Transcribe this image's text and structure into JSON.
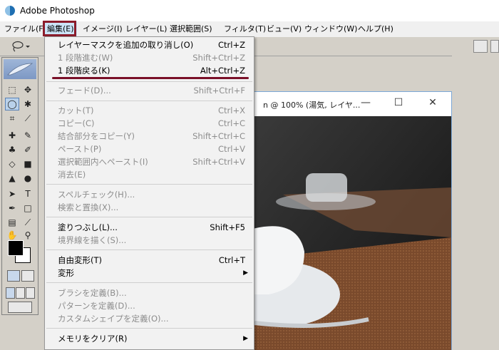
{
  "app": {
    "title": "Adobe Photoshop"
  },
  "menubar": {
    "items": [
      "ファイル(F)",
      "編集(E)",
      "イメージ(I)",
      "レイヤー(L)",
      "選択範囲(S)",
      "フィルタ(T)",
      "ビュー(V)",
      "ウィンドウ(W)",
      "ヘルプ(H)"
    ]
  },
  "document": {
    "title": "n @ 100% (湯気, レイヤ...",
    "minimize": "—",
    "maximize": "☐",
    "close": "✕"
  },
  "edit_menu": {
    "items": [
      {
        "label": "レイヤーマスクを追加の取り消し(O)",
        "shortcut": "Ctrl+Z",
        "enabled": true
      },
      {
        "label": "1 段階進む(W)",
        "shortcut": "Shift+Ctrl+Z",
        "enabled": false
      },
      {
        "label": "1 段階戻る(K)",
        "shortcut": "Alt+Ctrl+Z",
        "enabled": true
      },
      {
        "label": "フェード(D)...",
        "shortcut": "Shift+Ctrl+F",
        "enabled": false
      },
      {
        "label": "カット(T)",
        "shortcut": "Ctrl+X",
        "enabled": false
      },
      {
        "label": "コピー(C)",
        "shortcut": "Ctrl+C",
        "enabled": false
      },
      {
        "label": "結合部分をコピー(Y)",
        "shortcut": "Shift+Ctrl+C",
        "enabled": false
      },
      {
        "label": "ペースト(P)",
        "shortcut": "Ctrl+V",
        "enabled": false
      },
      {
        "label": "選択範囲内へペースト(I)",
        "shortcut": "Shift+Ctrl+V",
        "enabled": false
      },
      {
        "label": "消去(E)",
        "shortcut": "",
        "enabled": false
      },
      {
        "label": "スペルチェック(H)...",
        "shortcut": "",
        "enabled": false
      },
      {
        "label": "検索と置換(X)...",
        "shortcut": "",
        "enabled": false
      },
      {
        "label": "塗りつぶし(L)...",
        "shortcut": "Shift+F5",
        "enabled": true
      },
      {
        "label": "境界線を描く(S)...",
        "shortcut": "",
        "enabled": false
      },
      {
        "label": "自由変形(T)",
        "shortcut": "Ctrl+T",
        "enabled": true
      },
      {
        "label": "変形",
        "shortcut": "",
        "enabled": true,
        "submenu": true
      },
      {
        "label": "ブラシを定義(B)...",
        "shortcut": "",
        "enabled": false
      },
      {
        "label": "パターンを定義(D)...",
        "shortcut": "",
        "enabled": false
      },
      {
        "label": "カスタムシェイプを定義(O)...",
        "shortcut": "",
        "enabled": false
      },
      {
        "label": "メモリをクリア(R)",
        "shortcut": "",
        "enabled": true,
        "submenu": true
      }
    ]
  },
  "colors": {
    "highlight": "#8b1c2b",
    "underline": "#7a1028",
    "disabled_text": "#8d8d8d"
  }
}
